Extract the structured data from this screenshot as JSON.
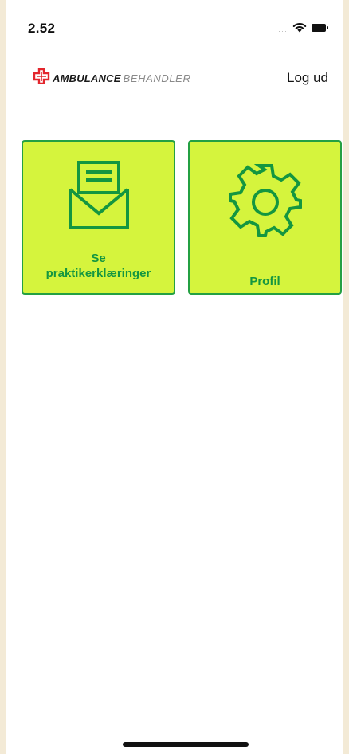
{
  "status_bar": {
    "time": "2.52",
    "signal_icon": "signal-dots-icon",
    "wifi_icon": "wifi-icon",
    "battery_icon": "battery-icon"
  },
  "header": {
    "logo_part1": "AMBULANCE",
    "logo_part2": "BEHANDLER",
    "logo_icon": "red-cross-logo-icon",
    "logout_label": "Log ud"
  },
  "tiles": [
    {
      "line1": "Se",
      "line2": "praktikerklæringer",
      "icon": "envelope-letter-icon"
    },
    {
      "label": "Profil",
      "icon": "gear-icon"
    }
  ],
  "colors": {
    "tile_background": "#d5f43d",
    "tile_border": "#24a043",
    "tile_text": "#149640",
    "logo_cross": "#e3262d"
  }
}
